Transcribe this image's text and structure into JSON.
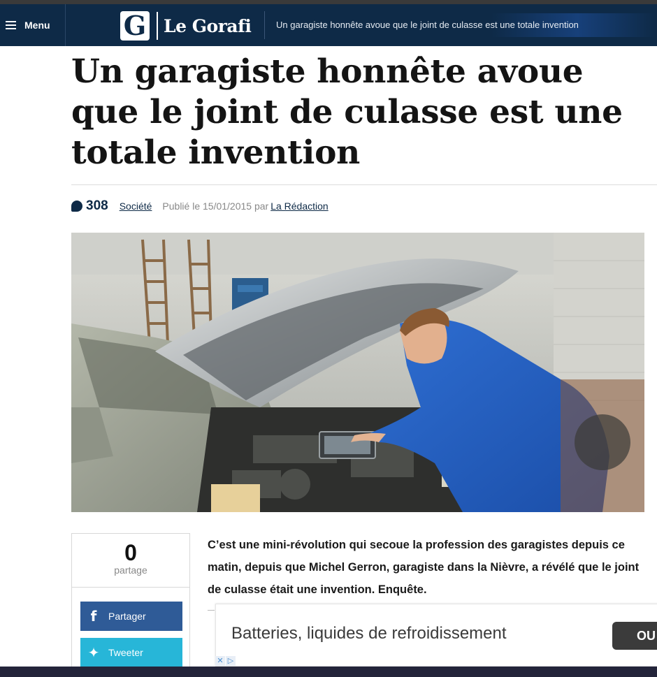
{
  "nav": {
    "menu_label": "Menu",
    "logo_letter": "G",
    "logo_text": "Le Gorafi",
    "headline": "Un garagiste honnête avoue que le joint de culasse est une totale invention"
  },
  "article": {
    "title": "Un garagiste honnête avoue que le joint de culasse est une totale invention",
    "comments_count": "308",
    "category": "Société",
    "published": "Publié le 15/01/2015 par",
    "author": "La Rédaction",
    "lead": "C’est une mini-révolution qui secoue la profession des garagistes depuis ce matin, depuis que Michel Gerron, garagiste dans la Nièvre, a révélé que le joint de culasse était une invention. Enquête."
  },
  "share": {
    "count": "0",
    "label": "partage",
    "facebook_icon": "f",
    "facebook_label": "Partager",
    "twitter_icon": "✦",
    "twitter_label": "Tweeter"
  },
  "ad": {
    "text": "Batteries, liquides de refroidissement",
    "button": "OU",
    "choice_close": "✕",
    "choice_info": "▷"
  },
  "colors": {
    "brand": "#0e2a47",
    "facebook": "#2f5b97",
    "twitter": "#27b6d8"
  }
}
